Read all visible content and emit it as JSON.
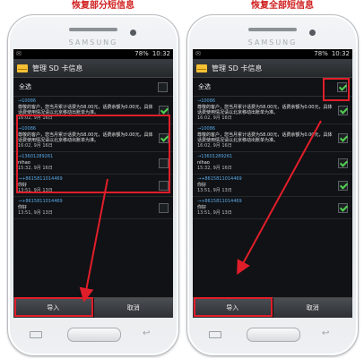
{
  "captions": {
    "left": "恢复部分短信息",
    "right": "恢复全部短信息"
  },
  "phones": {
    "brand": "SAMSUNG",
    "status_battery": "78%",
    "left_time": "10:32",
    "right_time": "10:32",
    "app_title": "管理 SD 卡信息",
    "select_all_label": "全选",
    "import_button": "导入",
    "cancel_button": "取消"
  },
  "messages": [
    {
      "from": "→10086",
      "text": "尊敬的客户，您当月累计话费为58.00元，话费余额为0.00元，具体话费使用情况请以北京移动出账单为准。",
      "time": "16:02, 9月 16日"
    },
    {
      "from": "→10086",
      "text": "尊敬的客户，您当月累计话费为58.00元，话费余额为0.00元，具体话费使用情况请以北京移动出账单为准。",
      "time": "16:02, 9月 16日"
    },
    {
      "from": "→13601289261",
      "text": "nihao",
      "time": "15:32, 9月 16日"
    },
    {
      "from": "→+8615811014469",
      "text": "你好",
      "time": "13:51, 9月 13日"
    },
    {
      "from": "→+8615811014469",
      "text": "你好",
      "time": "13:51, 9月 13日"
    },
    {
      "from": "→+8615811014469",
      "text": "你好",
      "time": "13:51, 9月 13日"
    }
  ],
  "left_checked": [
    true,
    true,
    false,
    false,
    false,
    false
  ],
  "right_checked": [
    true,
    true,
    true,
    true,
    true,
    true
  ],
  "right_select_all_checked": true,
  "colors": {
    "highlight": "#e01e2a",
    "check": "#52d152",
    "sender": "#5aa8e6",
    "caption": "#d02020"
  }
}
